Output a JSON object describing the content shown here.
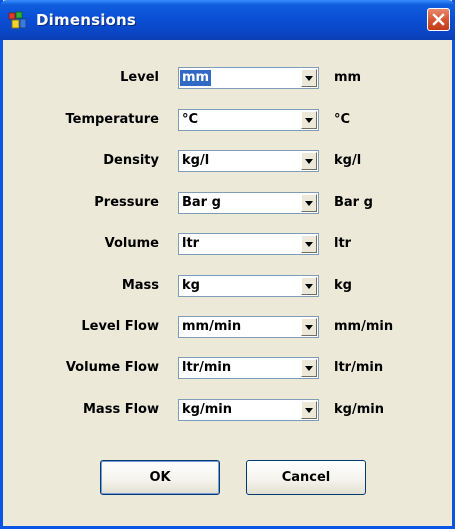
{
  "window": {
    "title": "Dimensions"
  },
  "rows": [
    {
      "label": "Level",
      "value": "mm",
      "unit": "mm"
    },
    {
      "label": "Temperature",
      "value": "°C",
      "unit": "°C"
    },
    {
      "label": "Density",
      "value": "kg/l",
      "unit": "kg/l"
    },
    {
      "label": "Pressure",
      "value": "Bar g",
      "unit": "Bar g"
    },
    {
      "label": "Volume",
      "value": "ltr",
      "unit": "ltr"
    },
    {
      "label": "Mass",
      "value": "kg",
      "unit": "kg"
    },
    {
      "label": "Level Flow",
      "value": "mm/min",
      "unit": "mm/min"
    },
    {
      "label": "Volume Flow",
      "value": "ltr/min",
      "unit": "ltr/min"
    },
    {
      "label": "Mass Flow",
      "value": "kg/min",
      "unit": "kg/min"
    }
  ],
  "buttons": {
    "ok": "OK",
    "cancel": "Cancel"
  },
  "colors": {
    "titlebar": "#0A4FD6",
    "dialog_bg": "#ECE9D8",
    "selection": "#316AC5",
    "close": "#D5532F"
  },
  "icons": {
    "app": "dimensions-app-icon",
    "close": "close-icon",
    "dropdown": "chevron-down-icon"
  }
}
